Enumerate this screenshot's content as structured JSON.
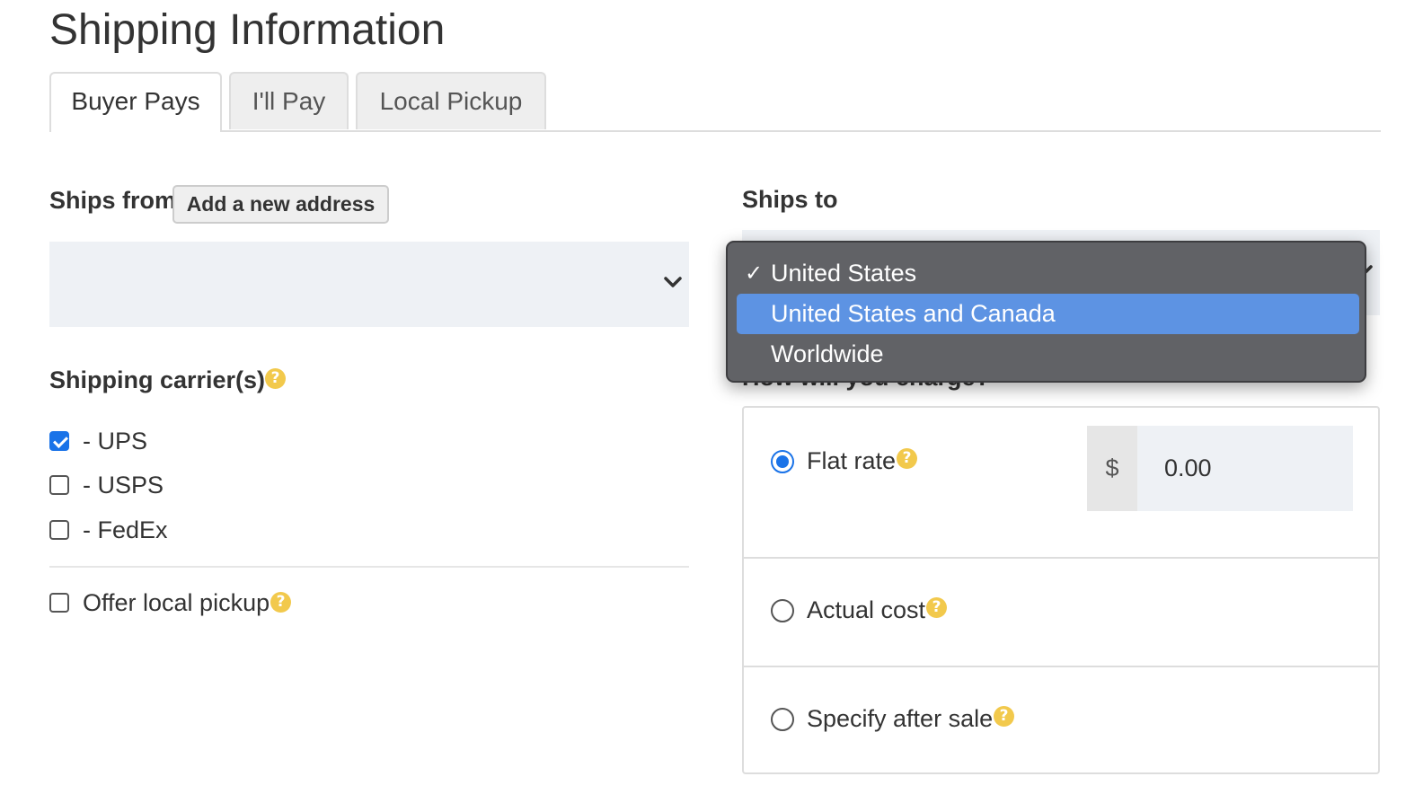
{
  "page": {
    "title": "Shipping Information"
  },
  "tabs": [
    {
      "label": "Buyer Pays",
      "active": true
    },
    {
      "label": "I'll Pay",
      "active": false
    },
    {
      "label": "Local Pickup",
      "active": false
    }
  ],
  "ships_from": {
    "label": "Ships from",
    "add_address_label": "Add a new address",
    "selected_value": ""
  },
  "carriers": {
    "label": "Shipping carrier(s)",
    "help_glyph": "?",
    "items": [
      {
        "label": "- UPS",
        "checked": true
      },
      {
        "label": "- USPS",
        "checked": false
      },
      {
        "label": "- FedEx",
        "checked": false
      }
    ]
  },
  "local_pickup": {
    "label": "Offer local pickup",
    "checked": false
  },
  "ships_to": {
    "label": "Ships to",
    "options": [
      {
        "label": "United States",
        "selected": true,
        "highlighted": false
      },
      {
        "label": "United States and Canada",
        "selected": false,
        "highlighted": true
      },
      {
        "label": "Worldwide",
        "selected": false,
        "highlighted": false
      }
    ],
    "check_glyph": "✓"
  },
  "charge": {
    "label": "How will you charge?",
    "options": [
      {
        "label": "Flat rate",
        "checked": true
      },
      {
        "label": "Actual cost",
        "checked": false
      },
      {
        "label": "Specify after sale",
        "checked": false
      }
    ],
    "currency_symbol": "$",
    "flat_rate_value": "0.00"
  },
  "colors": {
    "accent": "#1a73e8",
    "help_icon": "#f2c94c",
    "dropdown_bg": "#616266",
    "dropdown_highlight": "#5d93e3",
    "select_bg": "#eef1f5"
  }
}
